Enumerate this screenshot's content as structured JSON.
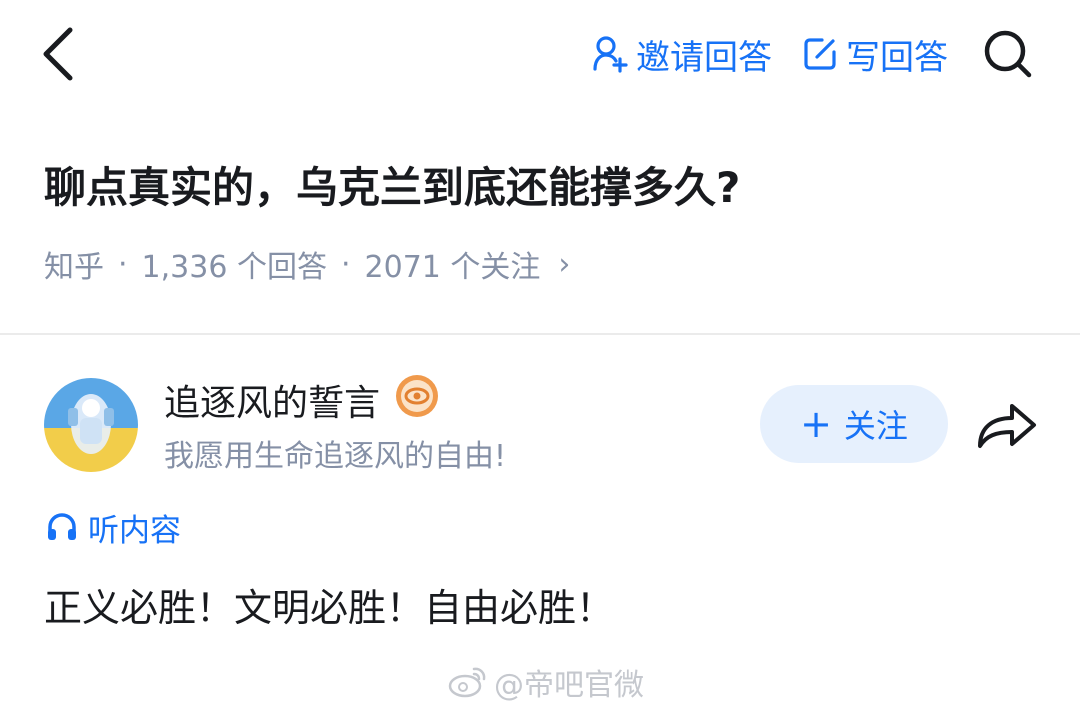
{
  "header": {
    "invite_label": "邀请回答",
    "write_label": "写回答",
    "accent": "#1772f6"
  },
  "question": {
    "title": "聊点真实的，乌克兰到底还能撑多久?",
    "source": "知乎",
    "answers_count": "1,336 个回答",
    "followers_count": "2071 个关注",
    "separator": "·",
    "chevron": "›"
  },
  "answer": {
    "author_name": "追逐风的誓言",
    "author_bio": "我愿用生命追逐风的自由!",
    "follow_label": "关注",
    "follow_plus": "+",
    "listen_label": "听内容",
    "content": "正义必胜！文明必胜！自由必胜！"
  },
  "watermark": {
    "text": "@帝吧官微"
  },
  "icons": [
    "back-arrow-icon",
    "invite-user-icon",
    "write-icon",
    "search-icon",
    "verified-badge-icon",
    "share-arrow-icon",
    "headphones-icon",
    "weibo-icon"
  ]
}
